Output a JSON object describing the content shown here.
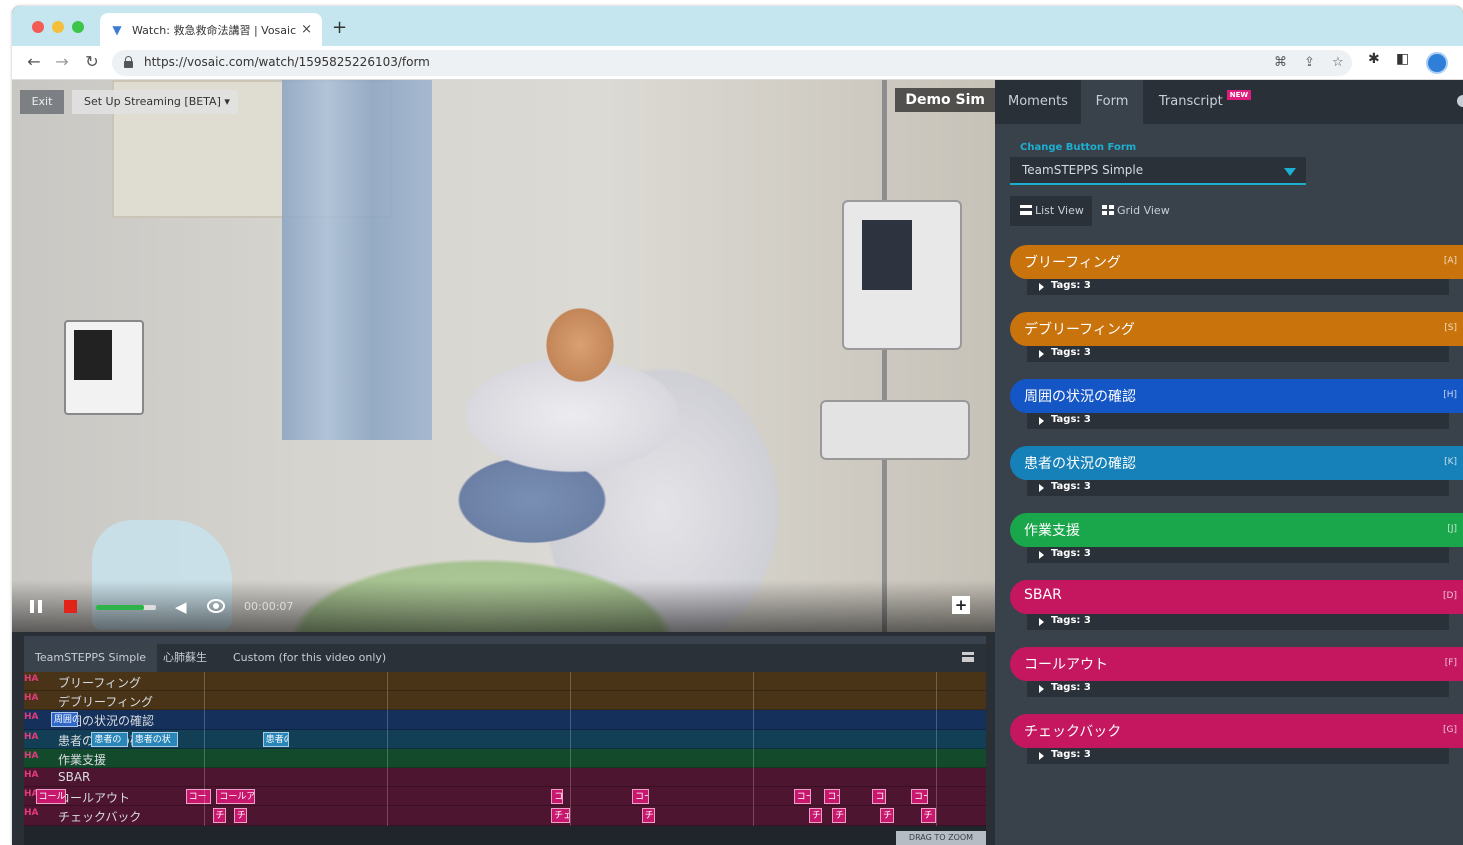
{
  "browser": {
    "tab_title": "Watch: 救急救命法講習 | Vosaic",
    "tab_close": "×",
    "new_tab": "+",
    "url": "https://vosaic.com/watch/1595825226103/form"
  },
  "video": {
    "exit_label": "Exit",
    "streaming_label": "Set Up Streaming [BETA] ▾",
    "title_badge": "Demo Sim",
    "time": "00:00:07",
    "volume": 0.8
  },
  "timeline": {
    "tabs": [
      "TeamSTEPPS Simple",
      "心肺蘇生",
      "Custom (for this video only)"
    ],
    "zoom_hint": "DRAG TO ZOOM",
    "rows": [
      {
        "ha": "HA",
        "name": "ブリーフィング",
        "color": "#4a3418",
        "marks": []
      },
      {
        "ha": "HA",
        "name": "デブリーフィング",
        "color": "#4a3418",
        "marks": []
      },
      {
        "ha": "HA",
        "name": "周囲の状況の確認",
        "color": "#15305a",
        "marks": [
          {
            "label": "周囲の",
            "t": 0.028,
            "w": 0.028,
            "c": "#2f68c9"
          }
        ]
      },
      {
        "ha": "HA",
        "name": "患者の状況の確認",
        "color": "#123f55",
        "marks": [
          {
            "label": "患者の",
            "t": 0.07,
            "w": 0.038,
            "c": "#2a86b8"
          },
          {
            "label": "患者の状",
            "t": 0.112,
            "w": 0.048,
            "c": "#2a86b8"
          },
          {
            "label": "患者の",
            "t": 0.248,
            "w": 0.028,
            "c": "#2a86b8"
          }
        ]
      },
      {
        "ha": "HA",
        "name": "作業支援",
        "color": "#144a2c",
        "marks": []
      },
      {
        "ha": "HA",
        "name": "SBAR",
        "color": "#4d1530",
        "marks": []
      },
      {
        "ha": "HA",
        "name": "コールアウト",
        "color": "#4d1530",
        "marks": [
          {
            "label": "コール",
            "t": 0.012,
            "w": 0.032,
            "c": "#c8186e"
          },
          {
            "label": "コー",
            "t": 0.168,
            "w": 0.026,
            "c": "#c8186e"
          },
          {
            "label": "コールア",
            "t": 0.2,
            "w": 0.04,
            "c": "#c8186e"
          },
          {
            "label": "コ",
            "t": 0.548,
            "w": 0.012,
            "c": "#c8186e"
          },
          {
            "label": "コー",
            "t": 0.632,
            "w": 0.018,
            "c": "#c8186e"
          },
          {
            "label": "コー",
            "t": 0.8,
            "w": 0.018,
            "c": "#c8186e"
          },
          {
            "label": "コー",
            "t": 0.832,
            "w": 0.016,
            "c": "#c8186e"
          },
          {
            "label": "コ",
            "t": 0.882,
            "w": 0.014,
            "c": "#c8186e"
          },
          {
            "label": "コー",
            "t": 0.922,
            "w": 0.018,
            "c": "#c8186e"
          }
        ]
      },
      {
        "ha": "HA",
        "name": "チェックバック",
        "color": "#4d1530",
        "marks": [
          {
            "label": "チ",
            "t": 0.196,
            "w": 0.014,
            "c": "#c8186e"
          },
          {
            "label": "チ",
            "t": 0.218,
            "w": 0.014,
            "c": "#c8186e"
          },
          {
            "label": "チェ",
            "t": 0.548,
            "w": 0.02,
            "c": "#c8186e"
          },
          {
            "label": "チ",
            "t": 0.642,
            "w": 0.014,
            "c": "#c8186e"
          },
          {
            "label": "チ",
            "t": 0.816,
            "w": 0.014,
            "c": "#c8186e"
          },
          {
            "label": "チ",
            "t": 0.84,
            "w": 0.014,
            "c": "#c8186e"
          },
          {
            "label": "チ",
            "t": 0.89,
            "w": 0.014,
            "c": "#c8186e"
          },
          {
            "label": "チ",
            "t": 0.932,
            "w": 0.016,
            "c": "#c8186e"
          }
        ]
      }
    ]
  },
  "sidebar": {
    "tabs": {
      "moments": "Moments",
      "form": "Form",
      "transcript": "Transcript",
      "new_badge": "NEW"
    },
    "change_label": "Change Button Form",
    "form_select": "TeamSTEPPS Simple",
    "list_view": "List View",
    "grid_view": "Grid View",
    "tags_label": "Tags: 3",
    "buttons": [
      {
        "label": "ブリーフィング",
        "key": "[A]",
        "color": "#c9730c"
      },
      {
        "label": "デブリーフィング",
        "key": "[S]",
        "color": "#c9730c"
      },
      {
        "label": "周囲の状況の確認",
        "key": "[H]",
        "color": "#1556c6"
      },
      {
        "label": "患者の状況の確認",
        "key": "[K]",
        "color": "#1681b8"
      },
      {
        "label": "作業支援",
        "key": "[J]",
        "color": "#1aa64a"
      },
      {
        "label": "SBAR",
        "key": "[D]",
        "color": "#c4175f"
      },
      {
        "label": "コールアウト",
        "key": "[F]",
        "color": "#c4175f"
      },
      {
        "label": "チェックバック",
        "key": "[G]",
        "color": "#c4175f"
      }
    ]
  }
}
